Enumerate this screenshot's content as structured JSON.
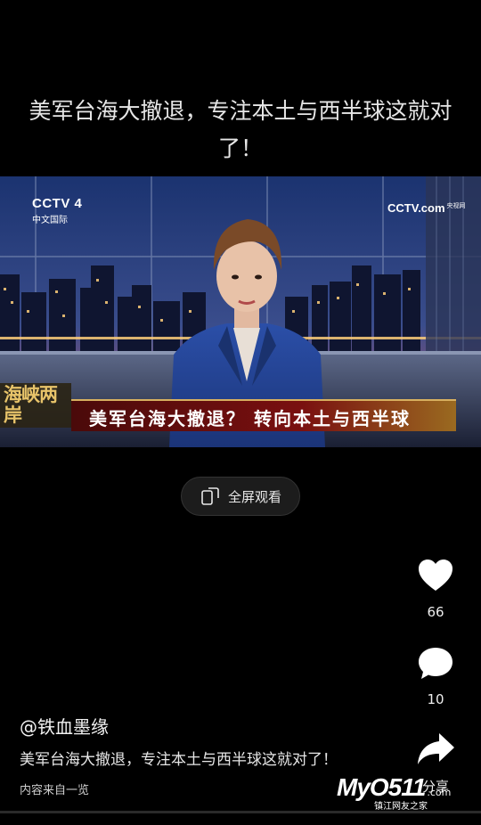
{
  "post": {
    "title": "美军台海大撤退，专注本土与西半球这就对了！",
    "author": "@铁血墨缘",
    "caption": "美军台海大撤退，专注本土与西半球这就对了！",
    "source": "内容来自一览"
  },
  "video": {
    "channel_logo": "CCTV 4",
    "channel_sub": "中文国际",
    "corner_logo": "CCTV.com",
    "corner_logo_sub": "央视网",
    "program_logo": "海峡两岸",
    "headline": "美军台海大撤退？ 转向本土与西半球",
    "fullscreen_label": "全屏观看"
  },
  "actions": {
    "likes": "66",
    "comments": "10",
    "share_label": "分享"
  },
  "watermark": {
    "brand": "MyO511",
    "domain": ".com",
    "tagline": "镇江网友之家"
  }
}
